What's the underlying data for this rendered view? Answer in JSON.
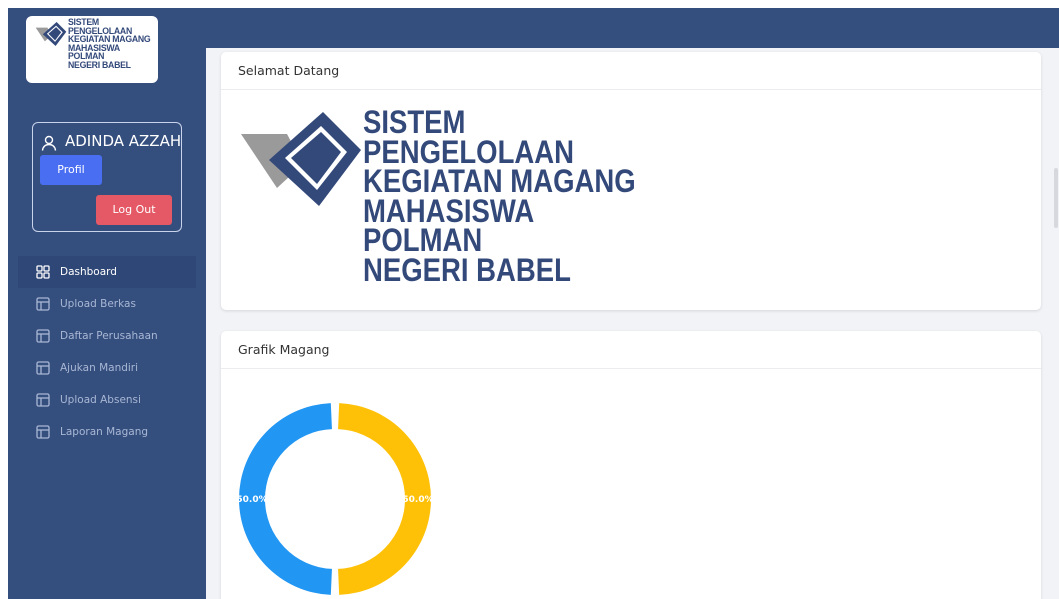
{
  "app": {
    "logo_lines": [
      "SISTEM",
      "PENGELOLAAN",
      "KEGIATAN MAGANG",
      "MAHASISWA",
      "POLMAN",
      "NEGERI BABEL"
    ],
    "logo_colors": {
      "navy": "#33497a",
      "gray": "#9a9a9a"
    }
  },
  "user": {
    "name": "ADINDA AZZAH",
    "profile_label": "Profil",
    "logout_label": "Log Out"
  },
  "sidebar": {
    "items": [
      {
        "label": "Dashboard",
        "icon": "grid-icon",
        "active": true
      },
      {
        "label": "Upload Berkas",
        "icon": "table-icon",
        "active": false
      },
      {
        "label": "Daftar Perusahaan",
        "icon": "table-icon",
        "active": false
      },
      {
        "label": "Ajukan Mandiri",
        "icon": "table-icon",
        "active": false
      },
      {
        "label": "Upload Absensi",
        "icon": "table-icon",
        "active": false
      },
      {
        "label": "Laporan Magang",
        "icon": "table-icon",
        "active": false
      }
    ]
  },
  "welcome_card": {
    "title": "Selamat Datang"
  },
  "chart_card": {
    "title": "Grafik Magang"
  },
  "chart_data": {
    "type": "pie",
    "donut": true,
    "values": [
      50.0,
      50.0
    ],
    "labels_shown": [
      "50.0%",
      "50.0%"
    ],
    "colors": [
      "#ffc107",
      "#2196f3"
    ]
  },
  "colors": {
    "sidebar_bg": "#344e7e",
    "primary_button": "#4a6ef2",
    "danger_button": "#e45965"
  }
}
